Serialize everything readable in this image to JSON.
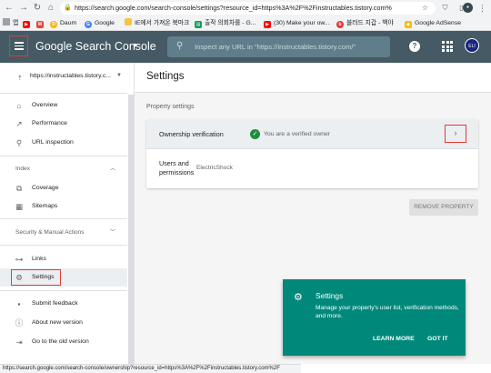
{
  "browser": {
    "url": "https://search.google.com/search-console/settings?resource_id=https%3A%2F%2Finstructables.tistory.com%",
    "bookmarks": [
      {
        "label": "앱",
        "icon": "apps-grid-icon",
        "color": "#ea4335"
      },
      {
        "label": "",
        "icon": "youtube-icon",
        "color": "#ff0000"
      },
      {
        "label": "",
        "icon": "gmail-icon",
        "color": "#ea4335"
      },
      {
        "label": "Daum",
        "icon": "daum-icon",
        "color": "#ffb300"
      },
      {
        "label": "Google",
        "icon": "google-icon",
        "color": "#4285f4"
      },
      {
        "label": "IE에서 가져온 북마크",
        "icon": "folder-icon",
        "color": "#f4c542"
      },
      {
        "label": "출작 의회차를 - G...",
        "icon": "sheets-icon",
        "color": "#0f9d58"
      },
      {
        "label": "(30) Make your ow...",
        "icon": "youtube-icon",
        "color": "#ff0000"
      },
      {
        "label": "블러드 지갑 - 백야",
        "icon": "blog-icon",
        "color": "#e53935"
      },
      {
        "label": "Google AdSense",
        "icon": "adsense-icon",
        "color": "#fbbc04"
      }
    ]
  },
  "header": {
    "logo_text": "Google Search Console",
    "search_placeholder": "Inspect any URL in \"https://instructables.tistory.com/\"",
    "avatar_text": "ELI"
  },
  "sidebar": {
    "property": "https://instructables.tistory.c...",
    "items_top": [
      {
        "label": "Overview",
        "icon": "home-icon"
      },
      {
        "label": "Performance",
        "icon": "trend-icon"
      },
      {
        "label": "URL inspection",
        "icon": "search-icon"
      }
    ],
    "section_index": "Index",
    "items_index": [
      {
        "label": "Coverage",
        "icon": "coverage-icon"
      },
      {
        "label": "Sitemaps",
        "icon": "sitemap-icon"
      }
    ],
    "section_security": "Security & Manual Actions",
    "items_bottom": [
      {
        "label": "Links",
        "icon": "links-icon"
      },
      {
        "label": "Settings",
        "icon": "gear-icon"
      }
    ],
    "items_footer": [
      {
        "label": "Submit feedback",
        "icon": "feedback-icon"
      },
      {
        "label": "About new version",
        "icon": "info-icon"
      },
      {
        "label": "Go to the old version",
        "icon": "exit-icon"
      }
    ]
  },
  "main": {
    "title": "Settings",
    "section_label": "Property settings",
    "ownership_label": "Ownership verification",
    "ownership_status": "You are a verified owner",
    "users_label": "Users and permissions",
    "users_value": "ElectricShock",
    "remove_button": "REMOVE PROPERTY"
  },
  "snackbar": {
    "title": "Settings",
    "text": "Manage your property's user list, verification methods, and more.",
    "learn_more": "LEARN MORE",
    "got_it": "GOT IT"
  },
  "status_bar": {
    "text": "https://search.google.com/search-console/ownership?resource_id=https%3A%2F%2Finstructables.tistory.com%2F"
  }
}
